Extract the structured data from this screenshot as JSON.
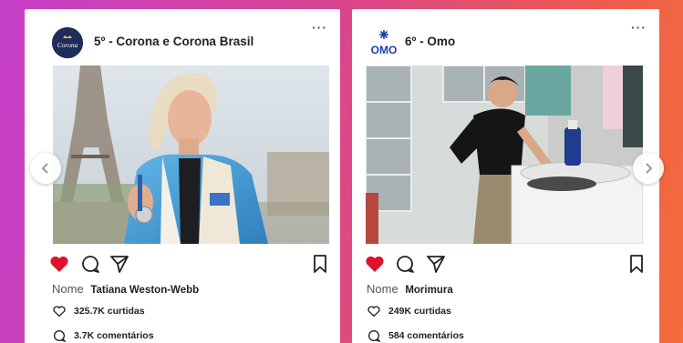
{
  "posts": [
    {
      "brand": "corona",
      "avatar_text": "Corona",
      "title": "5º - Corona e Corona Brasil",
      "name_label": "Nome",
      "name_value": "Tatiana Weston-Webb",
      "likes": "325.7K curtidas",
      "comments": "3.7K comentários",
      "liked": true
    },
    {
      "brand": "omo",
      "avatar_text": "OMO",
      "title": "6º -  Omo",
      "name_label": "Nome",
      "name_value": "Morimura",
      "likes": "249K curtidas",
      "comments": "584 comentários",
      "liked": true
    }
  ],
  "icons": {
    "like": "heart-icon",
    "comment": "comment-icon",
    "share": "send-icon",
    "save": "bookmark-icon",
    "more": "more-icon",
    "prev": "chevron-left-icon",
    "next": "chevron-right-icon"
  },
  "colors": {
    "liked_heart": "#e0112b",
    "card_bg": "#ffffff",
    "corona_avatar": "#1d2c5a",
    "omo_blue": "#1a3fa8"
  }
}
